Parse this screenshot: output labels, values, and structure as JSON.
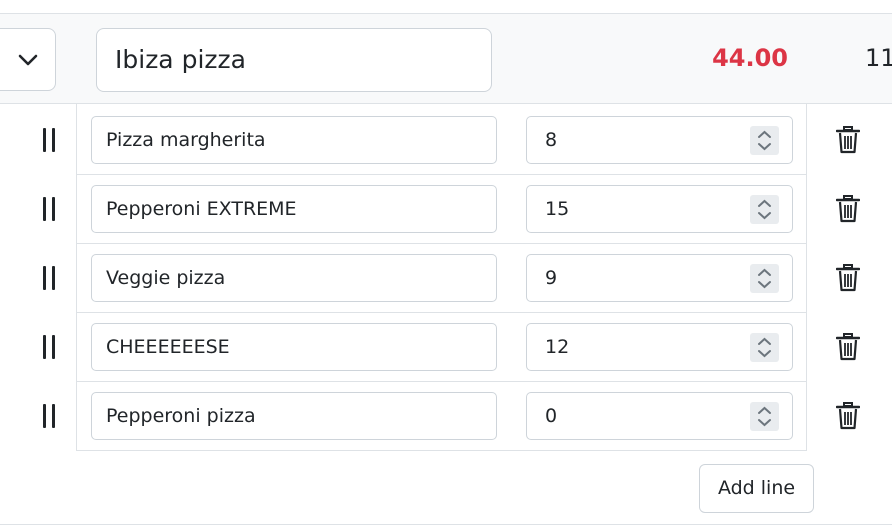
{
  "group": {
    "name": "Ibiza pizza",
    "total": "44.00",
    "trailing_value": "11",
    "toggle_icon": "chevron-down-icon"
  },
  "lines": [
    {
      "name": "Pizza margherita",
      "quantity": "8"
    },
    {
      "name": "Pepperoni EXTREME",
      "quantity": "15"
    },
    {
      "name": "Veggie pizza",
      "quantity": "9"
    },
    {
      "name": "CHEEEEEESE",
      "quantity": "12"
    },
    {
      "name": "Pepperoni pizza",
      "quantity": "0"
    }
  ],
  "icons": {
    "drag": "drag-handle-icon",
    "delete": "trash-icon",
    "stepper": "spinner-icon"
  },
  "actions": {
    "add_line_label": "Add line"
  },
  "colors": {
    "total": "#dc3545",
    "header_bg": "#f8f9fa",
    "border": "#ced4da"
  }
}
